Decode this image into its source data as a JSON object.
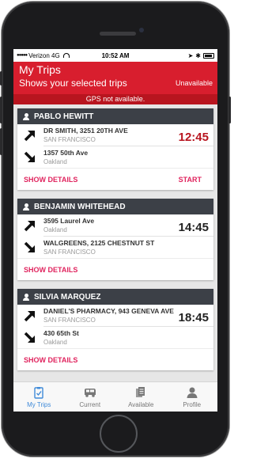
{
  "status_bar": {
    "carrier": "Verizon 4G",
    "time": "10:52 AM"
  },
  "header": {
    "title": "My Trips",
    "subtitle": "Shows your selected trips",
    "availability": "Unavailable",
    "gps_message": "GPS not available."
  },
  "trips": [
    {
      "passenger": "PABLO HEWITT",
      "pickup_name": "DR SMITH, 3251 20TH AVE",
      "pickup_city": "SAN FRANCISCO",
      "dropoff_name": "1357 50th Ave",
      "dropoff_city": "Oakland",
      "time": "12:45",
      "details_label": "SHOW DETAILS",
      "action_label": "START"
    },
    {
      "passenger": "BENJAMIN WHITEHEAD",
      "pickup_name": "3595 Laurel Ave",
      "pickup_city": "Oakland",
      "dropoff_name": "WALGREENS, 2125 CHESTNUT ST",
      "dropoff_city": "SAN FRANCISCO",
      "time": "14:45",
      "details_label": "SHOW DETAILS"
    },
    {
      "passenger": "SILVIA MARQUEZ",
      "pickup_name": "DANIEL'S PHARMACY, 943 GENEVA AVE",
      "pickup_city": "SAN FRANCISCO",
      "dropoff_name": "430 65th St",
      "dropoff_city": "Oakland",
      "time": "18:45",
      "details_label": "SHOW DETAILS"
    }
  ],
  "tabs": [
    {
      "label": "My Trips",
      "icon": "clipboard-check-icon",
      "active": true
    },
    {
      "label": "Current",
      "icon": "van-icon",
      "active": false
    },
    {
      "label": "Available",
      "icon": "documents-icon",
      "active": false
    },
    {
      "label": "Profile",
      "icon": "person-icon",
      "active": false
    }
  ],
  "colors": {
    "brand_red": "#d81e2e",
    "dark_red": "#b8151f",
    "link_pink": "#e0245e",
    "active_tab": "#3f8ad8",
    "card_header": "#3c4047"
  }
}
